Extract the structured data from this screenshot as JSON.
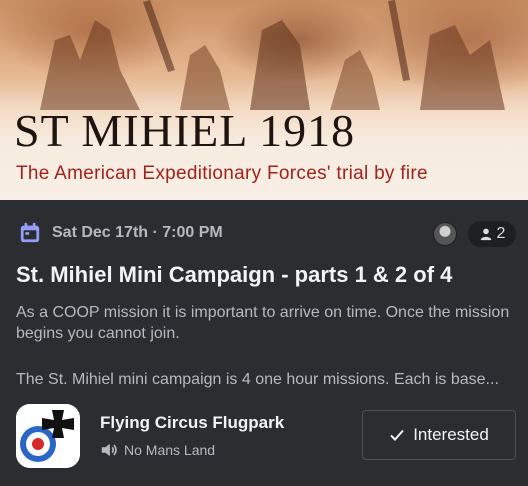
{
  "banner": {
    "title": "ST MIHIEL 1918",
    "subtitle": "The American Expeditionary Forces' trial by fire"
  },
  "event": {
    "datetime": "Sat Dec 17th · 7:00 PM",
    "attendee_count": "2",
    "title": "St. Mihiel Mini Campaign - parts 1 & 2 of 4",
    "description_p1": "As a COOP mission it is important to arrive on time. Once the mission begins you cannot join.",
    "description_p2": "The St. Mihiel mini campaign is 4 one hour missions. Each is base..."
  },
  "server": {
    "name": "Flying Circus Flugpark",
    "channel": "No Mans Land"
  },
  "actions": {
    "interested_label": "Interested"
  },
  "icons": {
    "calendar": "calendar-icon",
    "attendees": "person-icon",
    "channel": "speaker-icon",
    "interested": "check-icon"
  },
  "colors": {
    "accent_calendar": "#949cf7",
    "background": "#2b2d31",
    "subtitle_red": "#a3221b"
  }
}
